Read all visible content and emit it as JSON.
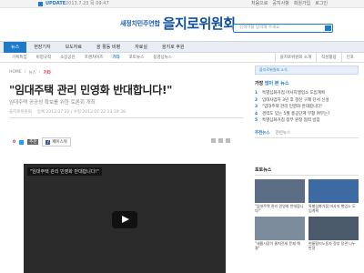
{
  "topbar": {
    "update_label": "UPDATE",
    "date": "2013.7.23 목 09:47",
    "links": [
      "처음으로",
      "공지사항",
      "회원가입",
      "로그인"
    ]
  },
  "header": {
    "logo_sub": "새정치민주연합",
    "logo_main": "을지로위원회",
    "search_placeholder": "검색어를 입력해 주세요"
  },
  "nav": {
    "items": [
      "뉴스",
      "현장기자",
      "보도자료",
      "을 활동 비평",
      "자료실",
      "을지로 후원"
    ]
  },
  "subnav": {
    "left": [
      "기획특집",
      "비정규직",
      "소상공인",
      "프랜차이즈",
      "기타",
      "포토뉴스",
      "동영상뉴스"
    ],
    "selected": "기타",
    "right": [
      "을지로위원회 소개",
      "작성활용",
      "인포"
    ]
  },
  "article": {
    "breadcrumb": [
      "HOME",
      "뉴스",
      "기타"
    ],
    "title": "\"임대주택 관리 민영화 반대합니다!\"",
    "subtitle": "임대주택 공공성 확보를 위한 토론회 개최",
    "meta_reporter": "을지로위원회",
    "meta_date": "등록 2013.07.22 | 수정 2013.07.22 13:19:38",
    "share_count_label": "0",
    "share_label": "추천",
    "facebook_label": "페이스북",
    "video_title": "\"임대주택 관리 민영화 반대합니다!\""
  },
  "sidebar": {
    "banner": "을지로위원회 소식",
    "popular_heading_pre": "가장 ",
    "popular_heading_em": "많이 본 뉴스",
    "popular": [
      {
        "n": "1",
        "text": "특별심화거점 마사지행업소 도입계획"
      },
      {
        "n": "2",
        "text": "임대사업자 3년 후 갱신 구제 단서 신설"
      },
      {
        "n": "3",
        "text": "\"임대주택 관리 민영화 반대합니다\""
      },
      {
        "n": "4",
        "text": "경력도 있는 5월 총공단계 부활 여부는?"
      },
      {
        "n": "5",
        "text": "특별심화거점 정부 원정 협력 방침"
      }
    ],
    "tabs": [
      "추천뉴스",
      "관련뉴스"
    ]
  },
  "photos": {
    "heading": "포토뉴스",
    "items": [
      {
        "caption": "\"임대주택 관리 민영화 반대합니다!\""
      },
      {
        "caption": "특별심화거점 마사지 행업소 도입계획"
      },
      {
        "caption": "\"새롭시장이 물지전세 문제 해결\""
      },
      {
        "caption": "현룸탈리노동자 정부 장관 나누 반정"
      }
    ]
  }
}
